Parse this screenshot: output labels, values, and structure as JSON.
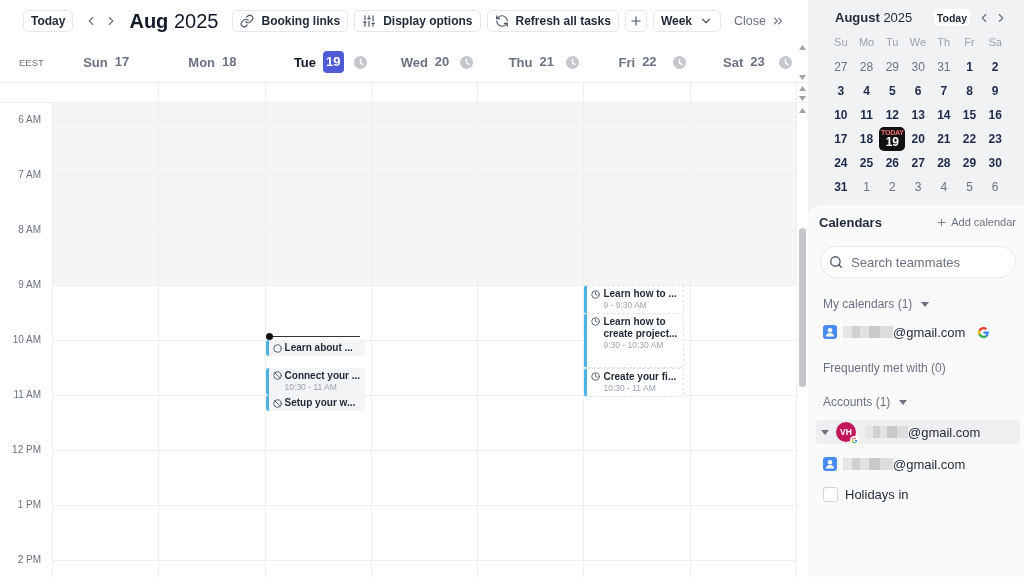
{
  "toolbar": {
    "today_button": "Today",
    "title": "**Aug** 2025",
    "actions": [
      {
        "kind": "link",
        "label": "Booking links"
      },
      {
        "kind": "sliders",
        "label": "Display options"
      },
      {
        "kind": "refresh",
        "label": "Refresh all tasks"
      },
      {
        "kind": "add"
      },
      {
        "kind": "dropdown",
        "label": "Week"
      }
    ],
    "close_button": "Close"
  },
  "week": {
    "timezone": "EEST",
    "hours": [
      {
        "label": "6 AM",
        "off_hours": true
      },
      {
        "label": "7 AM",
        "off_hours": true
      },
      {
        "label": "8 AM",
        "off_hours": true
      },
      {
        "label": "9 AM",
        "off_hours": false
      },
      {
        "label": "10 AM",
        "off_hours": false
      },
      {
        "label": "11 AM",
        "off_hours": false
      },
      {
        "label": "12 PM",
        "off_hours": false
      },
      {
        "label": "1 PM",
        "off_hours": false
      },
      {
        "label": "2 PM",
        "off_hours": false
      }
    ],
    "days": [
      {
        "weekday": "Sun",
        "date": "17",
        "selected": false,
        "clock": false,
        "slots": [
          {
            "now": false
          },
          {
            "now": false
          },
          {
            "now": false
          },
          {
            "now": false
          },
          {
            "now": false
          },
          {
            "now": false
          },
          {
            "now": false
          },
          {
            "now": false
          },
          {
            "now": false
          }
        ]
      },
      {
        "weekday": "Mon",
        "date": "18",
        "selected": false,
        "clock": false,
        "slots": [
          {
            "now": false
          },
          {
            "now": false
          },
          {
            "now": false
          },
          {
            "now": false
          },
          {
            "now": false
          },
          {
            "now": false
          },
          {
            "now": false
          },
          {
            "now": false
          },
          {
            "now": false
          }
        ]
      },
      {
        "weekday": "Tue",
        "date": "19",
        "selected": true,
        "clock": true,
        "slots": [
          {
            "now": false
          },
          {
            "now": false
          },
          {
            "now": false
          },
          {
            "now": true
          },
          {
            "now": false,
            "events": [
              {
                "kind": "task",
                "title": "Learn about ...",
                "at_half_hour": false,
                "hour_long": false
              },
              {
                "kind": "blocked",
                "title": "Connect your ...",
                "time": "10:30 - 11 AM",
                "at_half_hour": true,
                "hour_long": false
              }
            ]
          },
          {
            "now": false,
            "events": [
              {
                "kind": "blocked",
                "title": "Setup your w...",
                "at_half_hour": false,
                "hour_long": false
              }
            ]
          },
          {
            "now": false
          },
          {
            "now": false
          },
          {
            "now": false
          }
        ]
      },
      {
        "weekday": "Wed",
        "date": "20",
        "selected": false,
        "clock": true,
        "slots": [
          {
            "now": false
          },
          {
            "now": false
          },
          {
            "now": false
          },
          {
            "now": false
          },
          {
            "now": false
          },
          {
            "now": false
          },
          {
            "now": false
          },
          {
            "now": false
          },
          {
            "now": false
          }
        ]
      },
      {
        "weekday": "Thu",
        "date": "21",
        "selected": false,
        "clock": true,
        "slots": [
          {
            "now": false
          },
          {
            "now": false
          },
          {
            "now": false
          },
          {
            "now": false
          },
          {
            "now": false
          },
          {
            "now": false
          },
          {
            "now": false
          },
          {
            "now": false
          },
          {
            "now": false
          }
        ]
      },
      {
        "weekday": "Fri",
        "date": "22",
        "selected": false,
        "clock": true,
        "slots": [
          {
            "now": false
          },
          {
            "now": false
          },
          {
            "now": false
          },
          {
            "now": false,
            "events": [
              {
                "kind": "scheduled",
                "title": "Learn how to ...",
                "time": "9 - 9:30 AM",
                "at_half_hour": false,
                "hour_long": false
              },
              {
                "kind": "scheduled",
                "title": "Learn how to create project...",
                "time": "9:30 - 10:30 AM",
                "at_half_hour": true,
                "hour_long": true
              }
            ]
          },
          {
            "now": false,
            "events": [
              {
                "kind": "scheduled",
                "title": "Create your fi...",
                "time": "10:30 - 11 AM",
                "at_half_hour": true,
                "hour_long": false
              }
            ]
          },
          {
            "now": false
          },
          {
            "now": false
          },
          {
            "now": false
          },
          {
            "now": false
          }
        ]
      },
      {
        "weekday": "Sat",
        "date": "23",
        "selected": false,
        "clock": true,
        "slots": [
          {
            "now": false
          },
          {
            "now": false
          },
          {
            "now": false
          },
          {
            "now": false
          },
          {
            "now": false
          },
          {
            "now": false
          },
          {
            "now": false
          },
          {
            "now": false
          },
          {
            "now": false
          }
        ]
      }
    ]
  },
  "mini_calendar": {
    "title": "**August** 2025",
    "today_button": "Today",
    "weekdays": [
      "Su",
      "Mo",
      "Tu",
      "We",
      "Th",
      "Fr",
      "Sa"
    ],
    "weeks": [
      [
        {
          "label": "27",
          "muted": true,
          "selected": false
        },
        {
          "label": "28",
          "muted": true,
          "selected": false
        },
        {
          "label": "29",
          "muted": true,
          "selected": false
        },
        {
          "label": "30",
          "muted": true,
          "selected": false
        },
        {
          "label": "31",
          "muted": true,
          "selected": false
        },
        {
          "label": "1",
          "muted": false,
          "selected": false
        },
        {
          "label": "2",
          "muted": false,
          "selected": false
        }
      ],
      [
        {
          "label": "3",
          "muted": false,
          "selected": false
        },
        {
          "label": "4",
          "muted": false,
          "selected": false
        },
        {
          "label": "5",
          "muted": false,
          "selected": false
        },
        {
          "label": "6",
          "muted": false,
          "selected": false
        },
        {
          "label": "7",
          "muted": false,
          "selected": false
        },
        {
          "label": "8",
          "muted": false,
          "selected": false
        },
        {
          "label": "9",
          "muted": false,
          "selected": false
        }
      ],
      [
        {
          "label": "10",
          "muted": false,
          "selected": false
        },
        {
          "label": "11",
          "muted": false,
          "selected": false
        },
        {
          "label": "12",
          "muted": false,
          "selected": false
        },
        {
          "label": "13",
          "muted": false,
          "selected": false
        },
        {
          "label": "14",
          "muted": false,
          "selected": false
        },
        {
          "label": "15",
          "muted": false,
          "selected": false
        },
        {
          "label": "16",
          "muted": false,
          "selected": false
        }
      ],
      [
        {
          "label": "17",
          "muted": false,
          "selected": false
        },
        {
          "label": "18",
          "muted": false,
          "selected": false
        },
        {
          "label": "19",
          "muted": false,
          "selected": true,
          "badge": "TODAY"
        },
        {
          "label": "20",
          "muted": false,
          "selected": false
        },
        {
          "label": "21",
          "muted": false,
          "selected": false
        },
        {
          "label": "22",
          "muted": false,
          "selected": false
        },
        {
          "label": "23",
          "muted": false,
          "selected": false
        }
      ],
      [
        {
          "label": "24",
          "muted": false,
          "selected": false
        },
        {
          "label": "25",
          "muted": false,
          "selected": false
        },
        {
          "label": "26",
          "muted": false,
          "selected": false
        },
        {
          "label": "27",
          "muted": false,
          "selected": false
        },
        {
          "label": "28",
          "muted": false,
          "selected": false
        },
        {
          "label": "29",
          "muted": false,
          "selected": false
        },
        {
          "label": "30",
          "muted": false,
          "selected": false
        }
      ],
      [
        {
          "label": "31",
          "muted": false,
          "selected": false
        },
        {
          "label": "1",
          "muted": true,
          "selected": false
        },
        {
          "label": "2",
          "muted": true,
          "selected": false
        },
        {
          "label": "3",
          "muted": true,
          "selected": false
        },
        {
          "label": "4",
          "muted": true,
          "selected": false
        },
        {
          "label": "5",
          "muted": true,
          "selected": false
        },
        {
          "label": "6",
          "muted": true,
          "selected": false
        }
      ]
    ]
  },
  "calendars_panel": {
    "title": "Calendars",
    "add_button": "Add calendar",
    "search": {
      "placeholder": "Search teammates"
    },
    "sections": [
      {
        "kind": "group",
        "label": "My calendars (1)",
        "expanded": true,
        "items": [
          {
            "kind": "person",
            "redacted": true,
            "text": "@gmail.com",
            "google": true
          }
        ]
      },
      {
        "kind": "heading",
        "label": "Frequently met with (0)"
      },
      {
        "kind": "group",
        "label": "Accounts (1)",
        "expanded": true,
        "items": [
          {
            "kind": "account",
            "initials": "VH",
            "redacted": true,
            "text": "@gmail.com",
            "selected": true,
            "expanded": true,
            "children": [
              {
                "kind": "person",
                "redacted": true,
                "text": "@gmail.com",
                "google": false
              },
              {
                "kind": "checkbox",
                "text": "Holidays in",
                "checked": false
              }
            ]
          }
        ]
      }
    ]
  }
}
